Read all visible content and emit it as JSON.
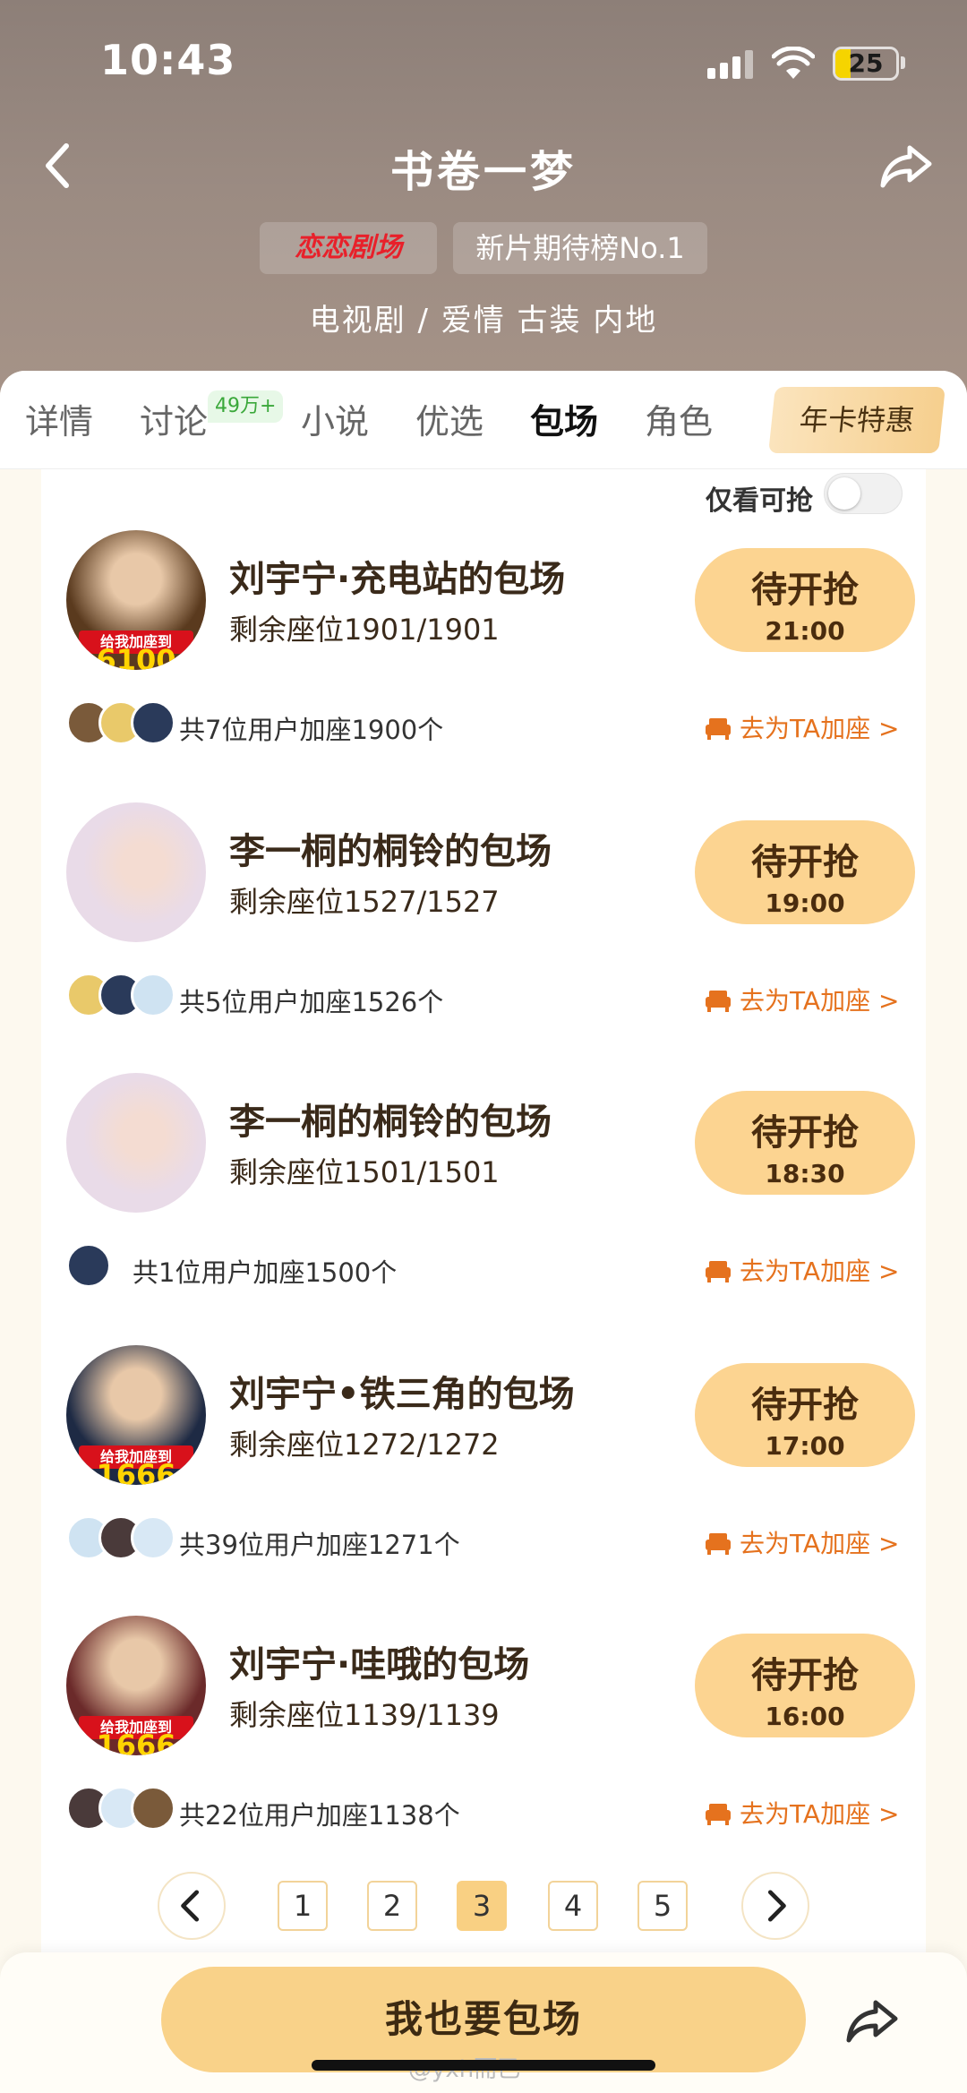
{
  "status": {
    "time": "10:43",
    "battery": "25"
  },
  "header": {
    "title": "书卷一梦",
    "badge_logo": "恋恋剧场",
    "badge_rank": "新片期待榜No.1",
    "genre": "电视剧 / 爱情 古装 内地"
  },
  "tabs": [
    {
      "label": "详情"
    },
    {
      "label": "讨论",
      "badge": "49万+"
    },
    {
      "label": "小说"
    },
    {
      "label": "优选"
    },
    {
      "label": "包场"
    },
    {
      "label": "角色"
    }
  ],
  "year_card": "年卡特惠",
  "filter": {
    "label": "仅看可抢",
    "on": false
  },
  "cards": [
    {
      "title": "刘宇宁·充电站的包场",
      "seats": "剩余座位1901/1901",
      "button": "待开抢",
      "time": "21:00",
      "users": "共7位用户加座1900个",
      "join": "去为TA加座 >",
      "avatar_text": "给我加座到",
      "avatar_num": "6100",
      "avatar_color": "#5a3a1e",
      "avatar_side": "充电站",
      "minis": 3
    },
    {
      "title": "李一桐的桐铃的包场",
      "seats": "剩余座位1527/1527",
      "button": "待开抢",
      "time": "19:00",
      "users": "共5位用户加座1526个",
      "join": "去为TA加座 >",
      "avatar_text": "",
      "avatar_num": "",
      "avatar_color": "#e9dbe8",
      "avatar_side": "",
      "minis": 3
    },
    {
      "title": "李一桐的桐铃的包场",
      "seats": "剩余座位1501/1501",
      "button": "待开抢",
      "time": "18:30",
      "users": "共1位用户加座1500个",
      "join": "去为TA加座 >",
      "avatar_text": "",
      "avatar_num": "",
      "avatar_color": "#e9dbe8",
      "avatar_side": "",
      "minis": 1
    },
    {
      "title": "刘宇宁•铁三角的包场",
      "seats": "剩余座位1272/1272",
      "button": "待开抢",
      "time": "17:00",
      "users": "共39位用户加座1271个",
      "join": "去为TA加座 >",
      "avatar_text": "给我加座到",
      "avatar_num": "1666",
      "avatar_color": "#1e2a44",
      "avatar_side": "铁三角",
      "minis": 3
    },
    {
      "title": "刘宇宁·哇哦的包场",
      "seats": "剩余座位1139/1139",
      "button": "待开抢",
      "time": "16:00",
      "users": "共22位用户加座1138个",
      "join": "去为TA加座 >",
      "avatar_text": "给我加座到",
      "avatar_num": "1666",
      "avatar_color": "#6b2a2a",
      "avatar_side": "哇哦",
      "minis": 3
    }
  ],
  "pager": {
    "pages": [
      "1",
      "2",
      "3",
      "4",
      "5"
    ],
    "current": "3"
  },
  "cta": "我也要包场",
  "watermark": "@yxh而已",
  "colors": {
    "accent": "#f9d289",
    "link": "#e5721e",
    "brand_red": "#e8202a"
  }
}
